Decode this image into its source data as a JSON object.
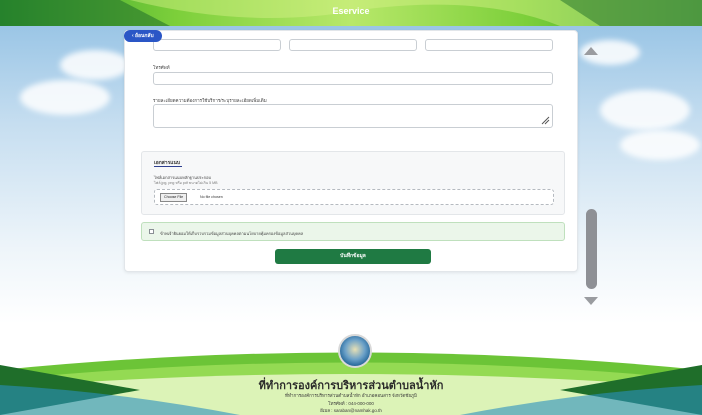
{
  "header": {
    "title": "Eservice",
    "back_label": "‹ ย้อนกลับ"
  },
  "form": {
    "phone_label": "โทรศัพท์",
    "details_label": "รายละเอียดความต้องการใช้บริการ/ระบุรายละเอียดเพิ่มเติม",
    "attachments": {
      "title": "เอกสารแนบ",
      "field_label": "ไฟล์เอกสารแนบหลักฐานประกอบ",
      "hint": "ไฟล์ jpg, png หรือ pdf ขนาดไม่เกิน 5 MB",
      "file_button": "Choose File",
      "file_status": "No file chosen"
    },
    "consent_text": "ข้าพเจ้ายินยอมให้เก็บรวบรวมข้อมูลส่วนบุคคลตามนโยบายคุ้มครองข้อมูลส่วนบุคคล",
    "save_label": "บันทึกข้อมูล"
  },
  "footer": {
    "org_name": "ที่ทำการองค์การบริหารส่วนตำบลน้ำหัก",
    "address": "ที่ทำการองค์การบริหารส่วนตำบลน้ำหัก อำเภอคอนสาร จังหวัดชัยภูมิ",
    "phone": "โทรศัพท์ : 044-000-000",
    "email": "อีเมล : saraban@namhak.go.th"
  },
  "colors": {
    "primary_green": "#1f7a43",
    "back_button": "#2a56c6",
    "consent_bg": "#ebf6ea"
  }
}
